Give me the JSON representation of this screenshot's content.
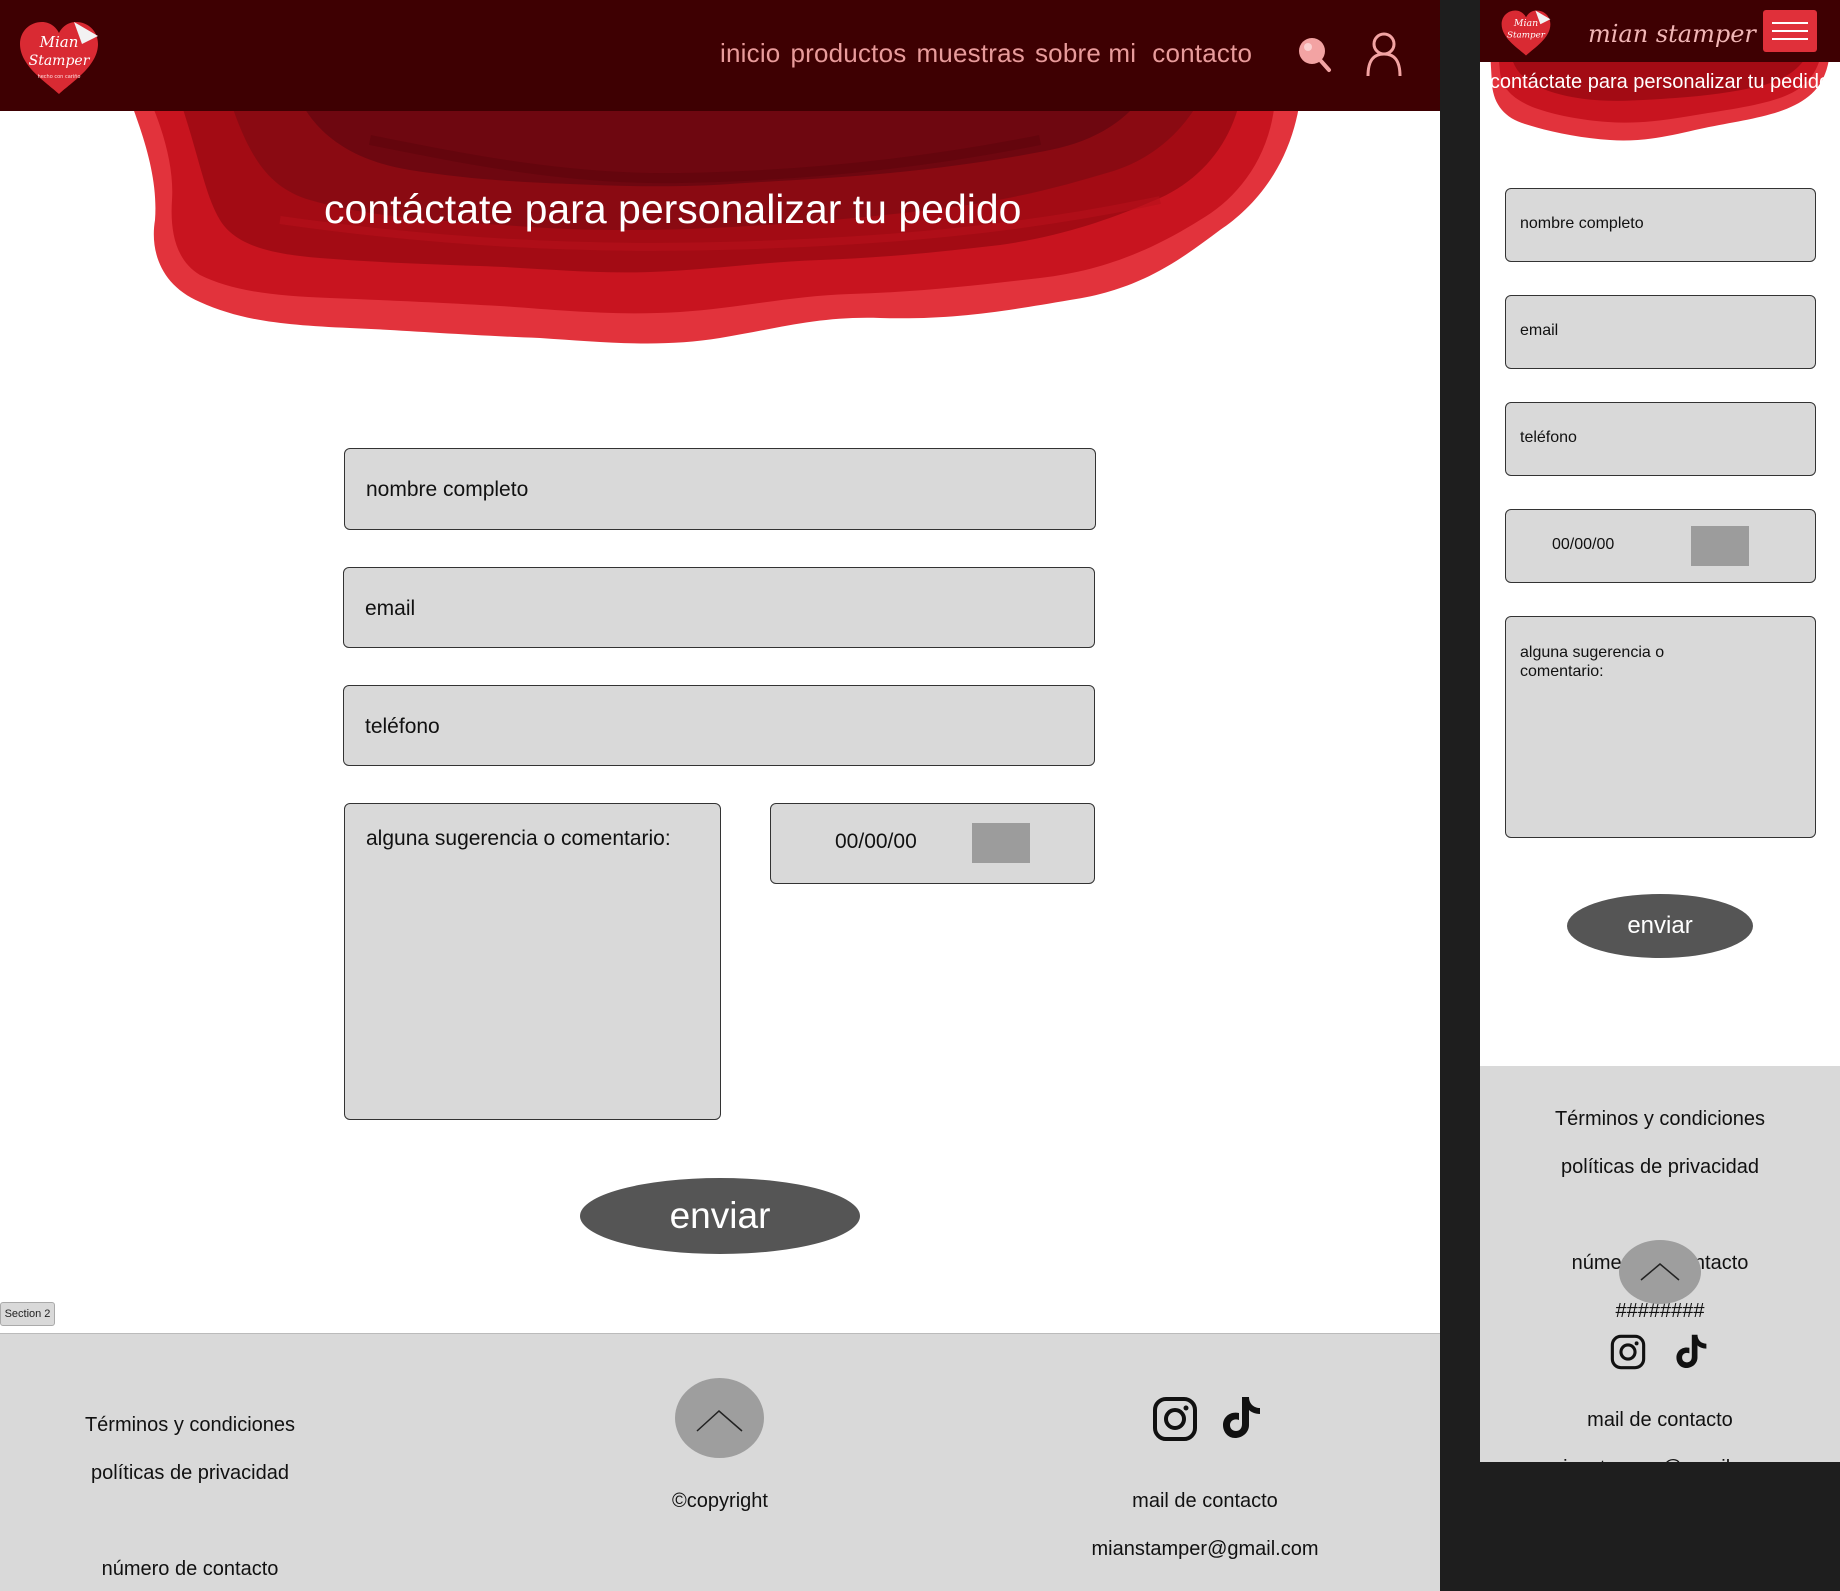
{
  "brand": {
    "logo_line1": "Mian",
    "logo_line2": "Stamper",
    "logo_tagline": "hecho con cariño",
    "mobile_name": "mian stamper"
  },
  "nav": {
    "items": [
      "inicio",
      "productos",
      "muestras",
      "sobre mi",
      "contacto"
    ],
    "icons": [
      "search-icon",
      "user-icon"
    ]
  },
  "hero": {
    "title": "contáctate para personalizar tu pedido"
  },
  "form": {
    "name_placeholder": "nombre completo",
    "email_placeholder": "email",
    "phone_placeholder": "teléfono",
    "comment_placeholder": "alguna sugerencia o comentario:",
    "date_value": "00/00/00",
    "submit_label": "enviar"
  },
  "section_tag": "Section 2",
  "footer": {
    "terms": "Términos y condiciones",
    "privacy": "políticas de privacidad",
    "phone_label": "número de contacto",
    "phone_value": "########",
    "copyright": "©copyright",
    "mail_label": "mail de contacto",
    "mail_value": "mianstamper@gmail.com",
    "social_icons": [
      "instagram-icon",
      "tiktok-icon"
    ]
  },
  "colors": {
    "header_bg": "#3e0002",
    "nav_text": "#e89b9b",
    "hero_red": "#d9252e",
    "field_bg": "#d9d9d9",
    "button_bg": "#555555",
    "canvas_bg": "#1e1e1e"
  }
}
